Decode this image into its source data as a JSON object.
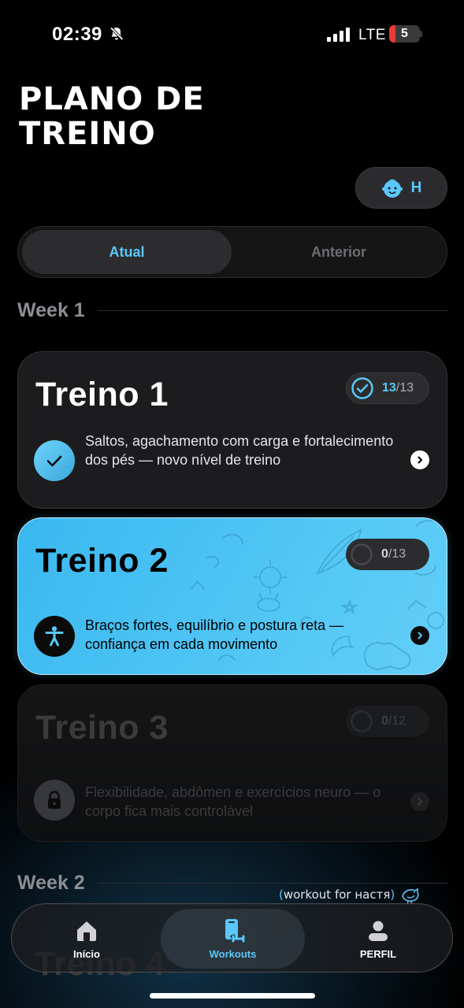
{
  "status_bar": {
    "time": "02:39",
    "network": "LTE",
    "battery": "5",
    "battery_level_percent": 5
  },
  "header": {
    "title": "PLANO DE TREINO",
    "avatar_letter": "H",
    "avatar_icon": "baby-face-icon"
  },
  "segments": {
    "current": "Atual",
    "previous": "Anterior"
  },
  "weeks": [
    {
      "label": "Week 1"
    },
    {
      "label": "Week 2"
    }
  ],
  "workouts": [
    {
      "title": "Treino 1",
      "done": "13",
      "total": "/13",
      "progress_fraction": 1.0,
      "description": "Saltos, agachamento com carga e fortalecimento dos pés — novo nível de treino",
      "state": "completed",
      "icon": "checkmark-icon"
    },
    {
      "title": "Treino 2",
      "done": "0",
      "total": "/13",
      "progress_fraction": 0,
      "description": "Braços fortes, equilíbrio e postura reta — confiança em cada movimento",
      "state": "current",
      "icon": "person-accessibility-icon"
    },
    {
      "title": "Treino 3",
      "done": "0",
      "total": "/12",
      "progress_fraction": 0,
      "description": "Flexibilidade, abdômen e exercícios neuro — o corpo fica mais controlável",
      "state": "locked",
      "icon": "lock-icon"
    },
    {
      "title": "Treino 4",
      "state": "partially-visible"
    }
  ],
  "dedication": {
    "open": "(",
    "text": "workout for настя",
    "close": ")",
    "icon": "bird-icon"
  },
  "tab_bar": {
    "home": "Início",
    "workouts": "Workouts",
    "profile": "PERFIL",
    "active": "Workouts"
  },
  "colors": {
    "accent": "#5ac8fa",
    "background": "#000000",
    "card": "#1c1c1e"
  }
}
